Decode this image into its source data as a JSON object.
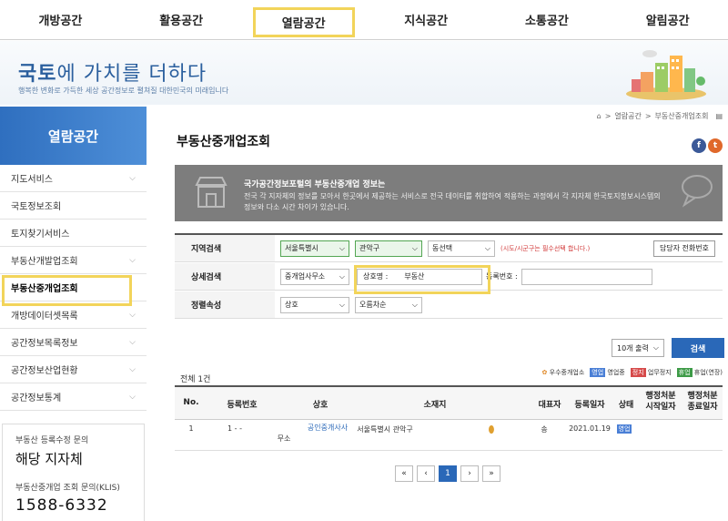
{
  "nav": {
    "items": [
      "개방공간",
      "활용공간",
      "열람공간",
      "지식공간",
      "소통공간",
      "알림공간"
    ]
  },
  "banner": {
    "title_a": "국토",
    "title_b": "에 가치를 더하다",
    "subtitle": "행복한 변화로 가득한 세상 공간정보로 펼쳐질 대한민국의 미래입니다"
  },
  "sidebar": {
    "heading": "열람공간",
    "items": [
      {
        "label": "지도서비스",
        "chevron": true
      },
      {
        "label": "국토정보조회",
        "chevron": false
      },
      {
        "label": "토지찾기서비스",
        "chevron": false
      },
      {
        "label": "부동산개발업조회",
        "chevron": true
      },
      {
        "label": "부동산중개업조회",
        "chevron": false
      },
      {
        "label": "개방데이터셋목록",
        "chevron": true
      },
      {
        "label": "공간정보목록정보",
        "chevron": true
      },
      {
        "label": "공간정보산업현황",
        "chevron": true
      },
      {
        "label": "공간정보통계",
        "chevron": true
      }
    ],
    "contact": {
      "label1": "부동산 등록수정 문의",
      "value1": "해당 지자체",
      "label2": "부동산중개업 조회 문의(KLIS)",
      "phone": "1588-6332"
    }
  },
  "breadcrumb": {
    "items": [
      "열람공간",
      "부동산중개업조회"
    ]
  },
  "page_title": "부동산중개업조회",
  "info": {
    "title": "국가공간정보포털의 부동산중개업 정보는",
    "desc": "전국 각 지자체의 정보를 모아서 한곳에서 제공하는 서비스로 전국 데이터를 취합하여 적용하는 과정에서 각 지자체 한국토지정보시스템의 정보와 다소 시간 차이가 있습니다."
  },
  "form": {
    "region_label": "지역검색",
    "sido": "서울특별시",
    "sigungu": "관악구",
    "dong": "동선택",
    "required_note": "(시도/시군구는 필수선택 합니다.)",
    "contact_btn": "담당자 전화번호",
    "detail_label": "상세검색",
    "detail_type": "중개업사무소",
    "trade_name_label": "상호명 :",
    "trade_name_value": "부동산",
    "reg_no_label": "등록번호 :",
    "reg_no_value": "",
    "sort_label": "정렬속성",
    "sort_field": "상호",
    "sort_order": "오름차순",
    "page_size": "10개 출력",
    "search_btn": "검색"
  },
  "result": {
    "total": "전체 1건",
    "legend": [
      {
        "tag": "",
        "text": "우수중개업소",
        "color": "#ffffff"
      },
      {
        "tag": "영업",
        "text": "영업중",
        "color": "#4a7fd6"
      },
      {
        "tag": "정지",
        "text": "업무정지",
        "color": "#d64a4a"
      },
      {
        "tag": "휴업",
        "text": "휴업(연장)",
        "color": "#3e9b48"
      }
    ]
  },
  "table": {
    "headers": [
      "No.",
      "등록번호",
      "상호",
      "소재지",
      "대표자",
      "등록일자",
      "상태",
      "행정처분\n시작일자",
      "행정처분\n종료일자"
    ],
    "rows": [
      {
        "no": "1",
        "reg": "1  -  -",
        "sub": "무소",
        "name": "공인중개사사",
        "addr": "서울특별시 관악구",
        "rep": "송",
        "date": "2021.01.19",
        "status": "영업"
      }
    ]
  },
  "pager": {
    "first": "«",
    "prev": "‹",
    "current": "1",
    "next": "›",
    "last": "»"
  }
}
